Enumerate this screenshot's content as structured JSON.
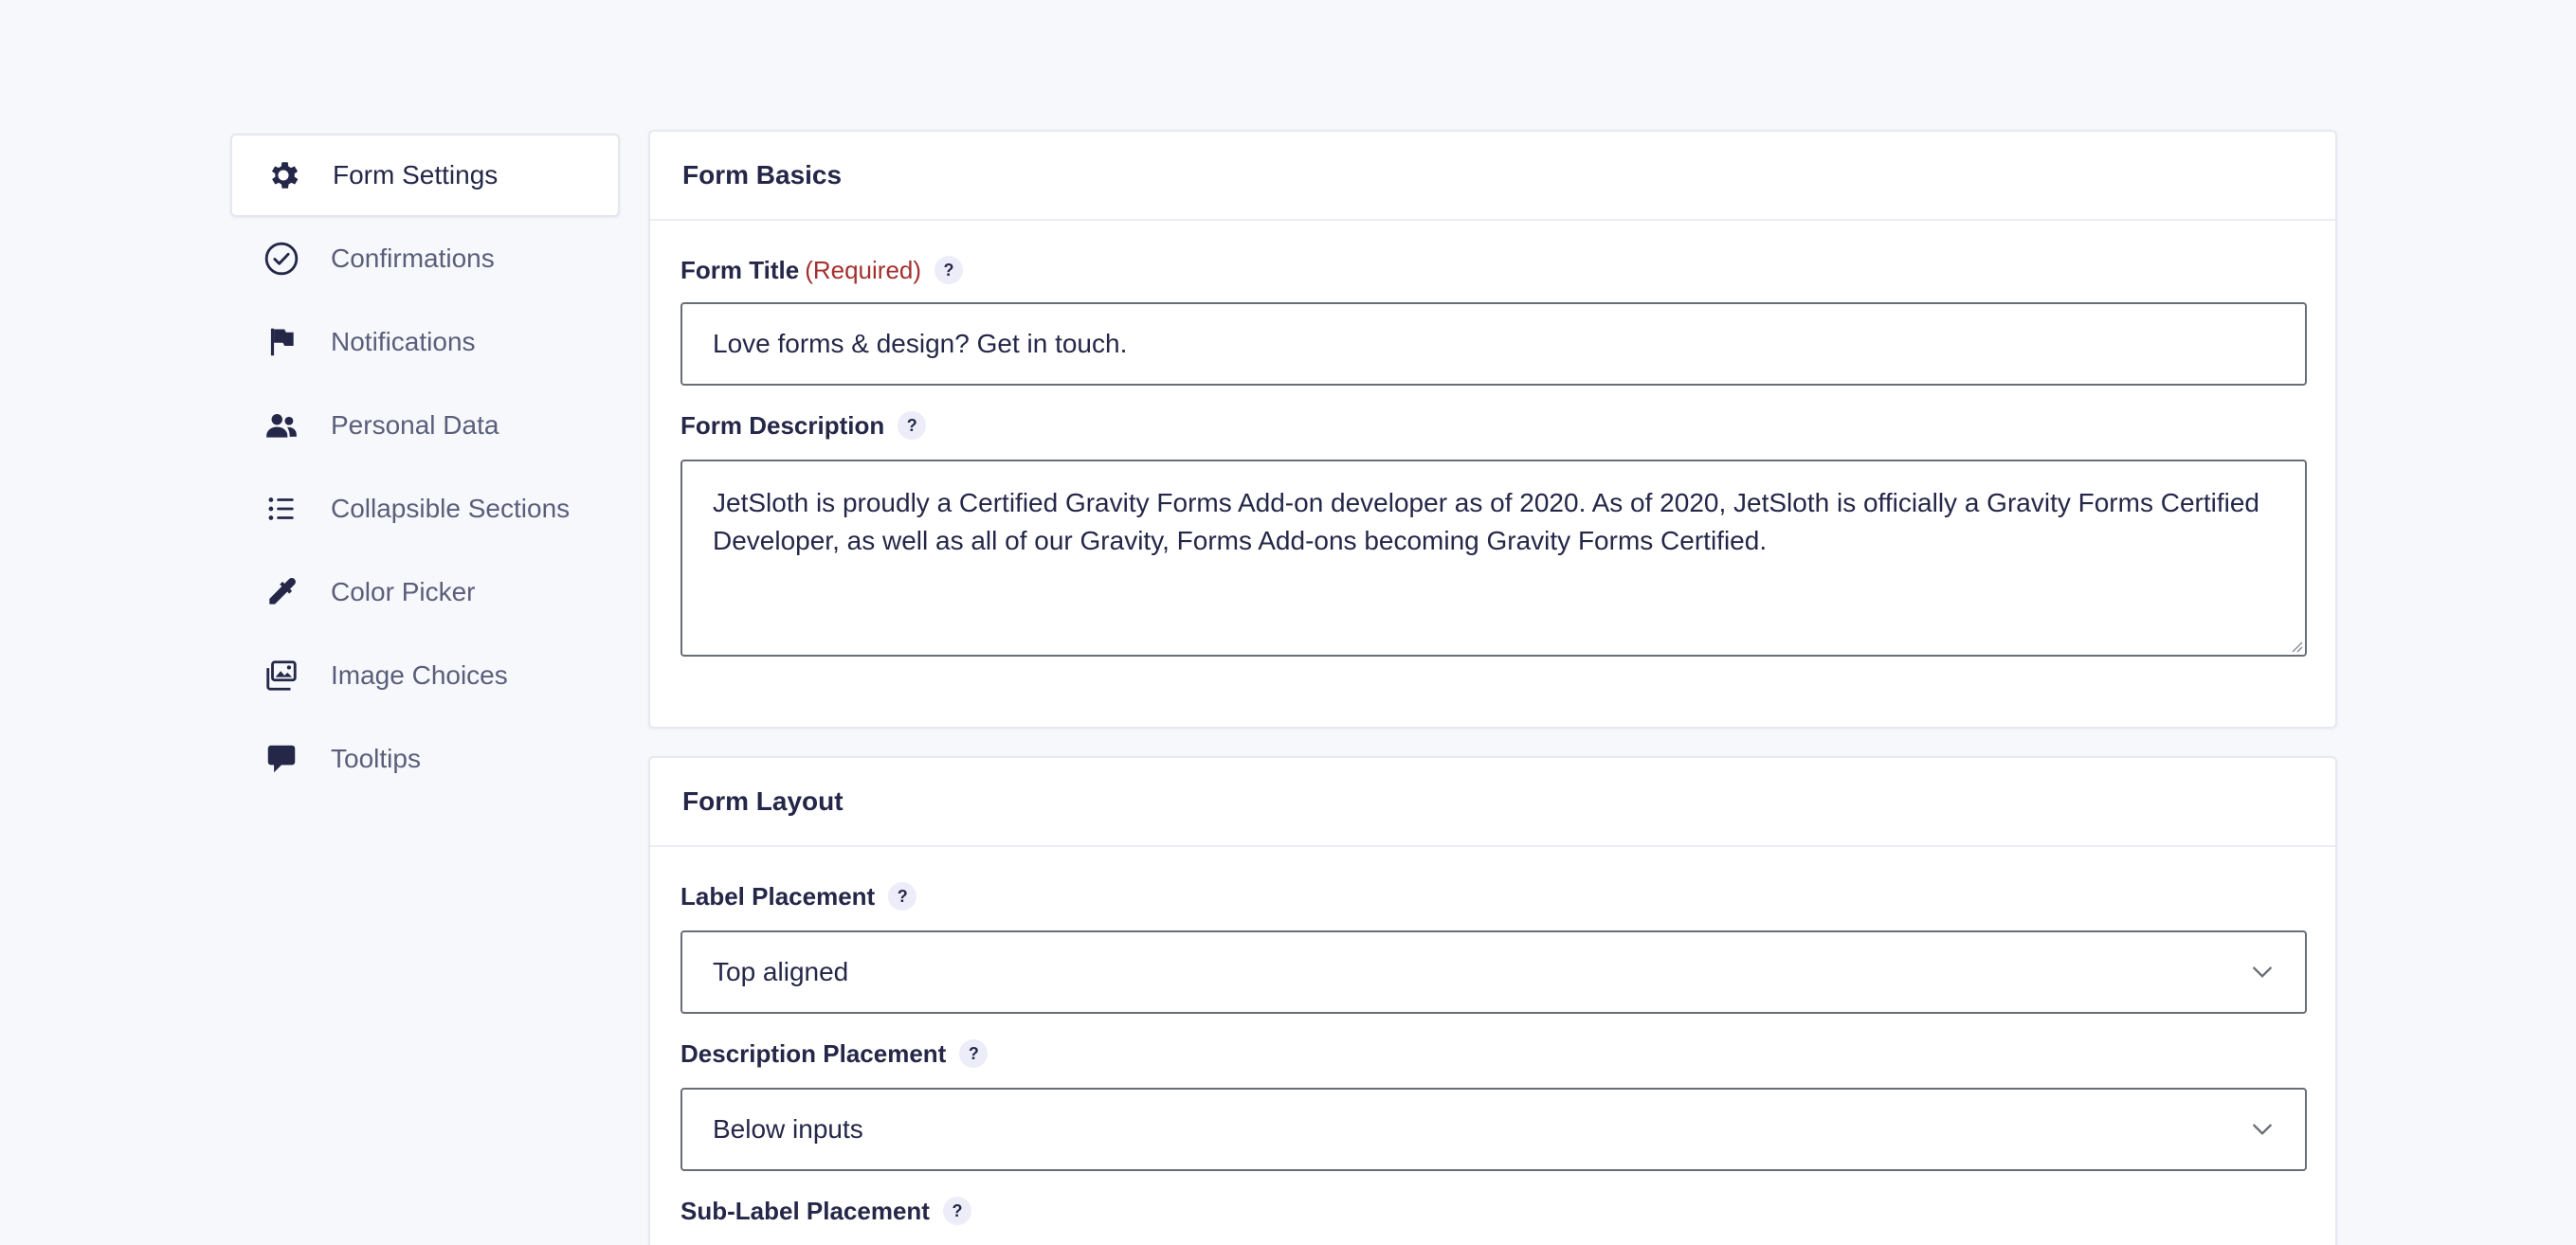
{
  "sidebar": {
    "items": [
      {
        "label": "Form Settings",
        "icon": "gear-icon"
      },
      {
        "label": "Confirmations",
        "icon": "check-circle-icon"
      },
      {
        "label": "Notifications",
        "icon": "flag-icon"
      },
      {
        "label": "Personal Data",
        "icon": "users-icon"
      },
      {
        "label": "Collapsible Sections",
        "icon": "list-icon"
      },
      {
        "label": "Color Picker",
        "icon": "eyedropper-icon"
      },
      {
        "label": "Image Choices",
        "icon": "images-icon"
      },
      {
        "label": "Tooltips",
        "icon": "speech-bubble-icon"
      }
    ]
  },
  "form_basics": {
    "title": "Form Basics",
    "form_title_label": "Form Title",
    "required_text": "(Required)",
    "form_title_value": "Love forms & design? Get in touch.",
    "description_label": "Form Description",
    "description_value": "JetSloth is proudly a Certified Gravity Forms Add-on developer as of 2020. As of 2020, JetSloth is officially a Gravity Forms Certified Developer, as well as all of our Gravity, Forms Add-ons becoming Gravity Forms Certified."
  },
  "form_layout": {
    "title": "Form Layout",
    "label_placement_label": "Label Placement",
    "label_placement_value": "Top aligned",
    "description_placement_label": "Description Placement",
    "description_placement_value": "Below inputs",
    "sublabel_placement_label": "Sub-Label Placement"
  },
  "help_glyph": "?",
  "colors": {
    "background": "#f6f8fb",
    "text": "#242748",
    "muted_text": "#5b5e7a",
    "required": "#a3302f",
    "input_border": "#686e77"
  }
}
